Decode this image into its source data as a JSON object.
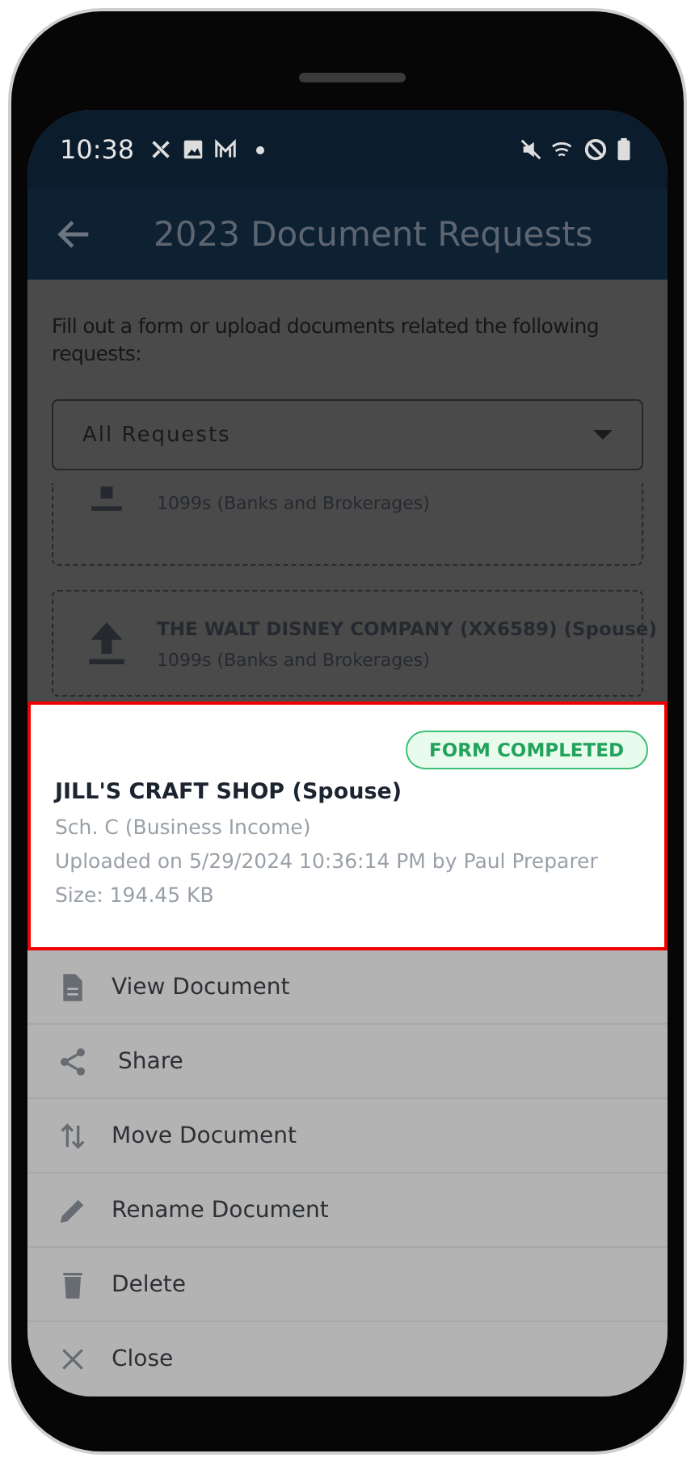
{
  "status_bar": {
    "time": "10:38"
  },
  "app_bar": {
    "title": "2023 Document Requests"
  },
  "intro": "Fill out a form or upload documents related the following requests:",
  "filter": {
    "value": "All Requests"
  },
  "requests": [
    {
      "category": "1099s (Banks and Brokerages)",
      "cut": true
    },
    {
      "title": "THE WALT DISNEY COMPANY (XX6589) (Spouse)",
      "category": "1099s (Banks and Brokerages)",
      "cut": false
    }
  ],
  "document": {
    "badge": "FORM COMPLETED",
    "title": "JILL'S CRAFT SHOP (Spouse)",
    "category": "Sch. C (Business Income)",
    "uploaded": "Uploaded on 5/29/2024 10:36:14 PM by Paul Preparer",
    "size": "Size: 194.45 KB"
  },
  "actions": [
    {
      "kind": "view",
      "label": "View Document"
    },
    {
      "kind": "share",
      "label": "Share"
    },
    {
      "kind": "move",
      "label": "Move Document"
    },
    {
      "kind": "rename",
      "label": "Rename Document"
    },
    {
      "kind": "delete",
      "label": "Delete"
    },
    {
      "kind": "close",
      "label": "Close"
    }
  ]
}
